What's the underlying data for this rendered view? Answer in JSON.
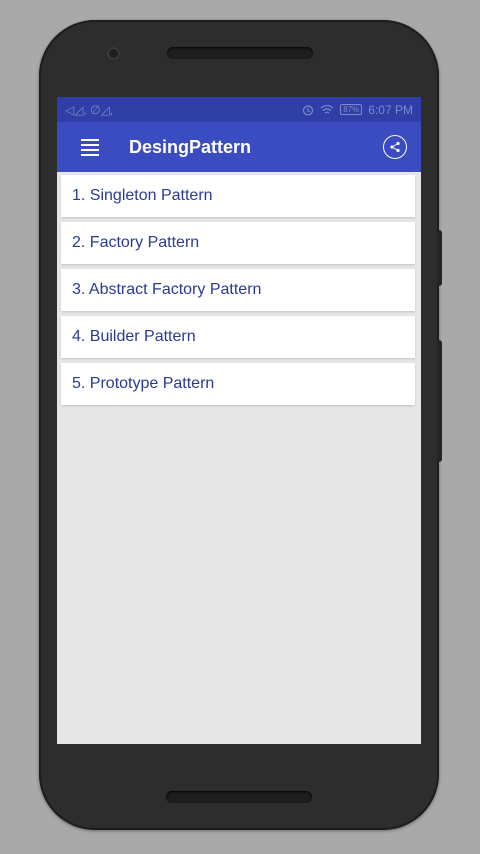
{
  "status_bar": {
    "left_indicators": "◁◿, ∅◿,",
    "alarm_icon": "alarm-icon",
    "wifi_icon": "wifi-icon",
    "battery": "87%",
    "time": "6:07 PM"
  },
  "app_bar": {
    "menu_icon": "menu-icon",
    "title": "DesingPattern",
    "share_icon": "share-icon"
  },
  "list": {
    "items": [
      {
        "label": "1. Singleton Pattern"
      },
      {
        "label": "2. Factory Pattern"
      },
      {
        "label": "3. Abstract Factory Pattern"
      },
      {
        "label": "4. Builder Pattern"
      },
      {
        "label": "5. Prototype Pattern"
      }
    ]
  },
  "colors": {
    "status_bar": "#2f3fa7",
    "app_bar": "#3a4cbf",
    "list_text": "#2b3a8f",
    "background": "#e6e6e6"
  }
}
